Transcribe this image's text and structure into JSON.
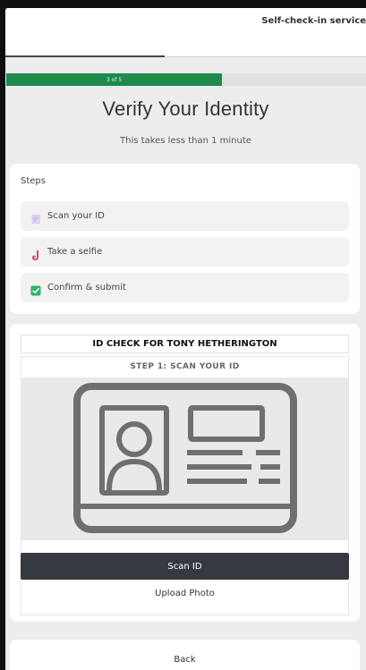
{
  "header": {
    "app_title": "Self-check-in service"
  },
  "progress": {
    "label": "3 of 5",
    "fraction": 0.6,
    "color": "#1e8a4c"
  },
  "page": {
    "title": "Verify Your Identity",
    "subtitle": "This takes less than 1 minute"
  },
  "steps": {
    "title": "Steps",
    "items": [
      {
        "label": "Scan your ID",
        "icon": "id-card-icon"
      },
      {
        "label": "Take a selfie",
        "icon": "selfie-icon"
      },
      {
        "label": "Confirm & submit",
        "icon": "checkbox-checked-icon"
      }
    ]
  },
  "id_check": {
    "title": "ID CHECK FOR TONY HETHERINGTON",
    "step_label": "STEP 1: SCAN YOUR ID",
    "illustration": "id-card-illustration",
    "scan_button": "Scan ID",
    "upload_link": "Upload Photo"
  },
  "footer": {
    "back_label": "Back"
  }
}
